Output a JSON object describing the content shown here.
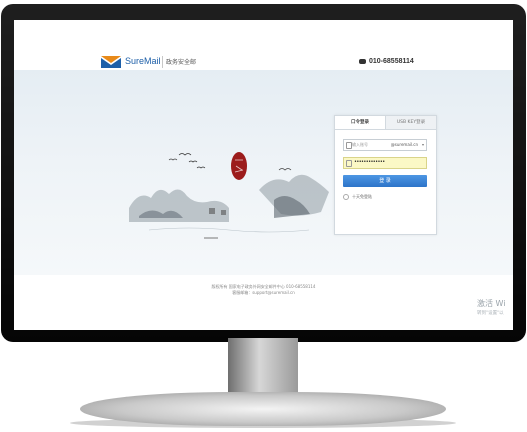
{
  "header": {
    "logo_text": "SureMail",
    "logo_subtitle": "政务安全邮",
    "phone": "010-68558114",
    "brand_blue": "#1d5fa8",
    "brand_orange": "#e88a1a"
  },
  "login": {
    "tabs": [
      "口令登录",
      "USB KEY登录"
    ],
    "username_placeholder": "输入账号",
    "domain": "@suremail.cn",
    "password_mask": "•••••••••••••",
    "login_button": "登 录",
    "remember_label": "十天免登陆",
    "button_color": "#3683d6"
  },
  "footer": {
    "line1": "版权所有 国家电子政务外网安全邮件中心 010-68558114",
    "line2": "客服邮箱：support@suremail.cn"
  },
  "watermark": {
    "title": "激活 Wi",
    "subtitle": "转到\"设置\"以"
  }
}
